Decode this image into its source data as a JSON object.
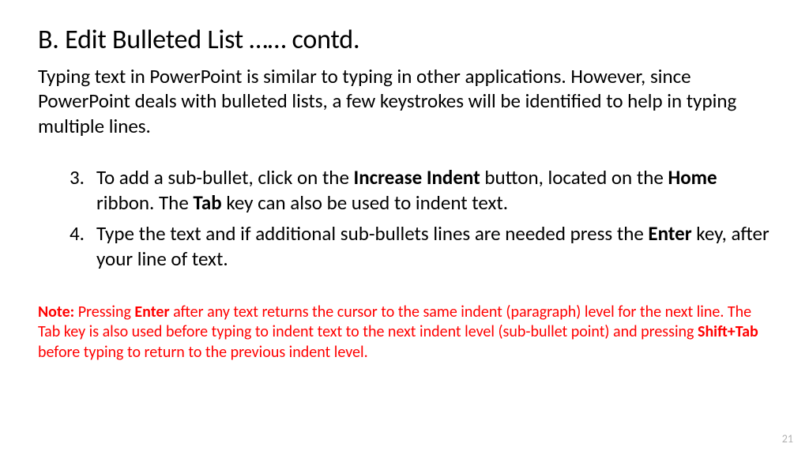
{
  "title": "B. Edit Bulleted List    …… contd.",
  "intro": "Typing text in PowerPoint is similar to typing in other applications. However, since PowerPoint deals with bulleted lists, a few keystrokes will be identified to help in typing multiple lines.",
  "items": [
    {
      "number": "3.",
      "text_pre": "To add a sub-bullet, click on the ",
      "bold1": "Increase Indent",
      "text_mid": " button, located on the ",
      "bold2": "Home",
      "text_mid2": " ribbon. The ",
      "bold3": "Tab",
      "text_post": " key can also be used to indent text."
    },
    {
      "number": "4.",
      "text_pre": "Type the text and if additional sub-bullets lines are needed press the ",
      "bold1": "Enter",
      "text_post": " key, after your line of text."
    }
  ],
  "note": {
    "label": "Note:",
    "t1": " Pressing ",
    "b1": "Enter",
    "t2": " after any text returns the cursor to the same indent (paragraph) level for the next line. The Tab key is also used before typing to indent text to the next indent level (sub-bullet point) and pressing ",
    "b2": "Shift+Tab",
    "t3": " before typing to return to the previous indent level."
  },
  "page_number": "21"
}
